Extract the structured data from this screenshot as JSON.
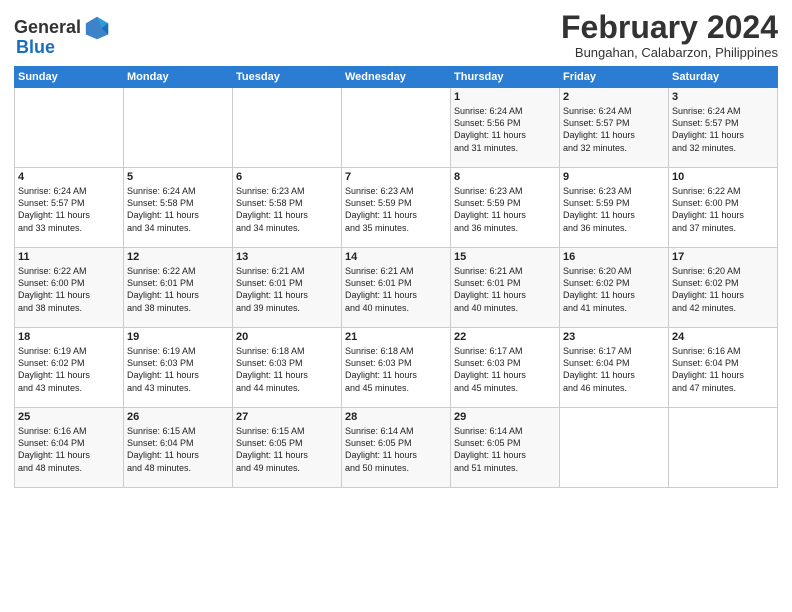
{
  "header": {
    "logo_general": "General",
    "logo_blue": "Blue",
    "title": "February 2024",
    "location": "Bungahan, Calabarzon, Philippines"
  },
  "days_of_week": [
    "Sunday",
    "Monday",
    "Tuesday",
    "Wednesday",
    "Thursday",
    "Friday",
    "Saturday"
  ],
  "weeks": [
    [
      {
        "day": "",
        "info": ""
      },
      {
        "day": "",
        "info": ""
      },
      {
        "day": "",
        "info": ""
      },
      {
        "day": "",
        "info": ""
      },
      {
        "day": "1",
        "info": "Sunrise: 6:24 AM\nSunset: 5:56 PM\nDaylight: 11 hours\nand 31 minutes."
      },
      {
        "day": "2",
        "info": "Sunrise: 6:24 AM\nSunset: 5:57 PM\nDaylight: 11 hours\nand 32 minutes."
      },
      {
        "day": "3",
        "info": "Sunrise: 6:24 AM\nSunset: 5:57 PM\nDaylight: 11 hours\nand 32 minutes."
      }
    ],
    [
      {
        "day": "4",
        "info": "Sunrise: 6:24 AM\nSunset: 5:57 PM\nDaylight: 11 hours\nand 33 minutes."
      },
      {
        "day": "5",
        "info": "Sunrise: 6:24 AM\nSunset: 5:58 PM\nDaylight: 11 hours\nand 34 minutes."
      },
      {
        "day": "6",
        "info": "Sunrise: 6:23 AM\nSunset: 5:58 PM\nDaylight: 11 hours\nand 34 minutes."
      },
      {
        "day": "7",
        "info": "Sunrise: 6:23 AM\nSunset: 5:59 PM\nDaylight: 11 hours\nand 35 minutes."
      },
      {
        "day": "8",
        "info": "Sunrise: 6:23 AM\nSunset: 5:59 PM\nDaylight: 11 hours\nand 36 minutes."
      },
      {
        "day": "9",
        "info": "Sunrise: 6:23 AM\nSunset: 5:59 PM\nDaylight: 11 hours\nand 36 minutes."
      },
      {
        "day": "10",
        "info": "Sunrise: 6:22 AM\nSunset: 6:00 PM\nDaylight: 11 hours\nand 37 minutes."
      }
    ],
    [
      {
        "day": "11",
        "info": "Sunrise: 6:22 AM\nSunset: 6:00 PM\nDaylight: 11 hours\nand 38 minutes."
      },
      {
        "day": "12",
        "info": "Sunrise: 6:22 AM\nSunset: 6:01 PM\nDaylight: 11 hours\nand 38 minutes."
      },
      {
        "day": "13",
        "info": "Sunrise: 6:21 AM\nSunset: 6:01 PM\nDaylight: 11 hours\nand 39 minutes."
      },
      {
        "day": "14",
        "info": "Sunrise: 6:21 AM\nSunset: 6:01 PM\nDaylight: 11 hours\nand 40 minutes."
      },
      {
        "day": "15",
        "info": "Sunrise: 6:21 AM\nSunset: 6:01 PM\nDaylight: 11 hours\nand 40 minutes."
      },
      {
        "day": "16",
        "info": "Sunrise: 6:20 AM\nSunset: 6:02 PM\nDaylight: 11 hours\nand 41 minutes."
      },
      {
        "day": "17",
        "info": "Sunrise: 6:20 AM\nSunset: 6:02 PM\nDaylight: 11 hours\nand 42 minutes."
      }
    ],
    [
      {
        "day": "18",
        "info": "Sunrise: 6:19 AM\nSunset: 6:02 PM\nDaylight: 11 hours\nand 43 minutes."
      },
      {
        "day": "19",
        "info": "Sunrise: 6:19 AM\nSunset: 6:03 PM\nDaylight: 11 hours\nand 43 minutes."
      },
      {
        "day": "20",
        "info": "Sunrise: 6:18 AM\nSunset: 6:03 PM\nDaylight: 11 hours\nand 44 minutes."
      },
      {
        "day": "21",
        "info": "Sunrise: 6:18 AM\nSunset: 6:03 PM\nDaylight: 11 hours\nand 45 minutes."
      },
      {
        "day": "22",
        "info": "Sunrise: 6:17 AM\nSunset: 6:03 PM\nDaylight: 11 hours\nand 45 minutes."
      },
      {
        "day": "23",
        "info": "Sunrise: 6:17 AM\nSunset: 6:04 PM\nDaylight: 11 hours\nand 46 minutes."
      },
      {
        "day": "24",
        "info": "Sunrise: 6:16 AM\nSunset: 6:04 PM\nDaylight: 11 hours\nand 47 minutes."
      }
    ],
    [
      {
        "day": "25",
        "info": "Sunrise: 6:16 AM\nSunset: 6:04 PM\nDaylight: 11 hours\nand 48 minutes."
      },
      {
        "day": "26",
        "info": "Sunrise: 6:15 AM\nSunset: 6:04 PM\nDaylight: 11 hours\nand 48 minutes."
      },
      {
        "day": "27",
        "info": "Sunrise: 6:15 AM\nSunset: 6:05 PM\nDaylight: 11 hours\nand 49 minutes."
      },
      {
        "day": "28",
        "info": "Sunrise: 6:14 AM\nSunset: 6:05 PM\nDaylight: 11 hours\nand 50 minutes."
      },
      {
        "day": "29",
        "info": "Sunrise: 6:14 AM\nSunset: 6:05 PM\nDaylight: 11 hours\nand 51 minutes."
      },
      {
        "day": "",
        "info": ""
      },
      {
        "day": "",
        "info": ""
      }
    ]
  ]
}
